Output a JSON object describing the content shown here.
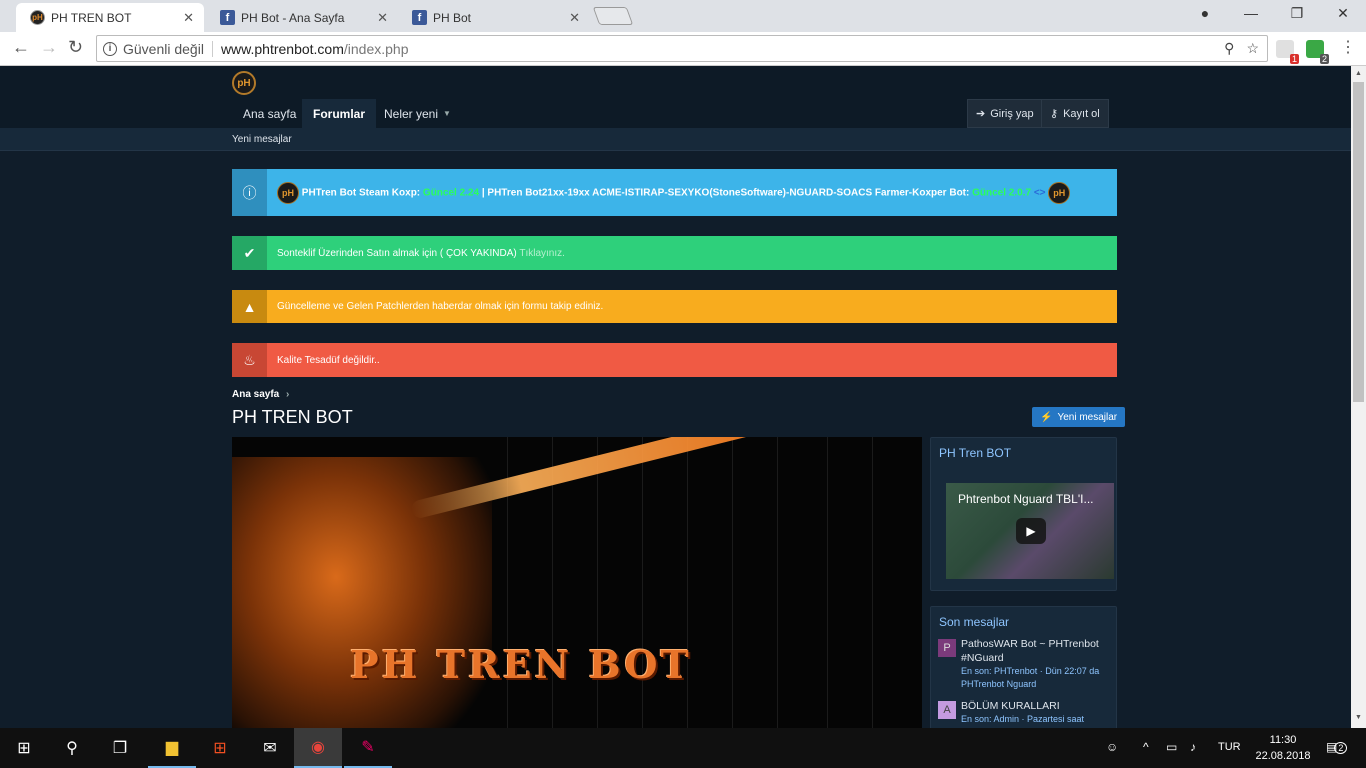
{
  "browser": {
    "tabs": [
      {
        "title": "PH TREN BOT",
        "favicon": "pH",
        "active": true
      },
      {
        "title": "PH Bot - Ana Sayfa",
        "favicon": "f",
        "active": false
      },
      {
        "title": "PH Bot",
        "favicon": "f",
        "active": false
      }
    ],
    "tab_close": "✕",
    "security_label": "Güvenli değil",
    "url_domain": "www.phtrenbot.com",
    "url_path": "/index.php",
    "ext_badges": [
      "1",
      "2"
    ]
  },
  "site": {
    "logo": "pH",
    "nav": [
      {
        "label": "Ana sayfa"
      },
      {
        "label": "Forumlar",
        "active": true
      },
      {
        "label": "Neler yeni"
      }
    ],
    "login": "Giriş yap",
    "register": "Kayıt ol",
    "subnav": "Yeni mesajlar"
  },
  "notices": {
    "info": {
      "badge": "pH",
      "part1": "PHTren Bot Steam Koxp:",
      "part1_link": "Güncel 2.24",
      "part2": " | PHTren Bot21xx-19xx ACME-ISTIRAP-SEXYKO(StoneSoftware)-NGUARD-SOACS Farmer-Koxper Bot:",
      "part2_link": "Güncel 2.0.7",
      "tail": "<>"
    },
    "success": {
      "text": "Sonteklif Üzerinden Satın almak için ( ÇOK YAKINDA)",
      "link": "Tıklayınız."
    },
    "warning": {
      "text": "Güncelleme ve Gelen Patchlerden haberdar olmak için formu takip ediniz."
    },
    "danger": {
      "text": "Kalite Tesadüf değildir.."
    }
  },
  "main": {
    "breadcrumb": "Ana sayfa",
    "breadcrumb_sep": "›",
    "title": "PH TREN BOT",
    "new_posts_button": "Yeni mesajlar",
    "banner_text": "PH TREN BOT"
  },
  "sidebar": {
    "video_block": {
      "title": "PH Tren BOT",
      "video_title": "Phtrenbot Nguard TBL'I..."
    },
    "latest": {
      "title": "Son mesajlar",
      "posts": [
        {
          "avatar": "P",
          "avatar_color": "#7b3a7b",
          "title": "PathosWAR Bot ~ PHTrenbot #NGuard",
          "meta": "En son: PHTrenbot · Dün 22:07 da PHTrenbot Nguard"
        },
        {
          "avatar": "A",
          "avatar_color": "#c49be0",
          "title": "BÖLÜM KURALLARI",
          "meta": "En son: Admin · Pazartesi saat"
        }
      ]
    }
  },
  "taskbar": {
    "lang": "TUR",
    "time": "11:30",
    "date": "22.08.2018",
    "notif_count": "2"
  }
}
